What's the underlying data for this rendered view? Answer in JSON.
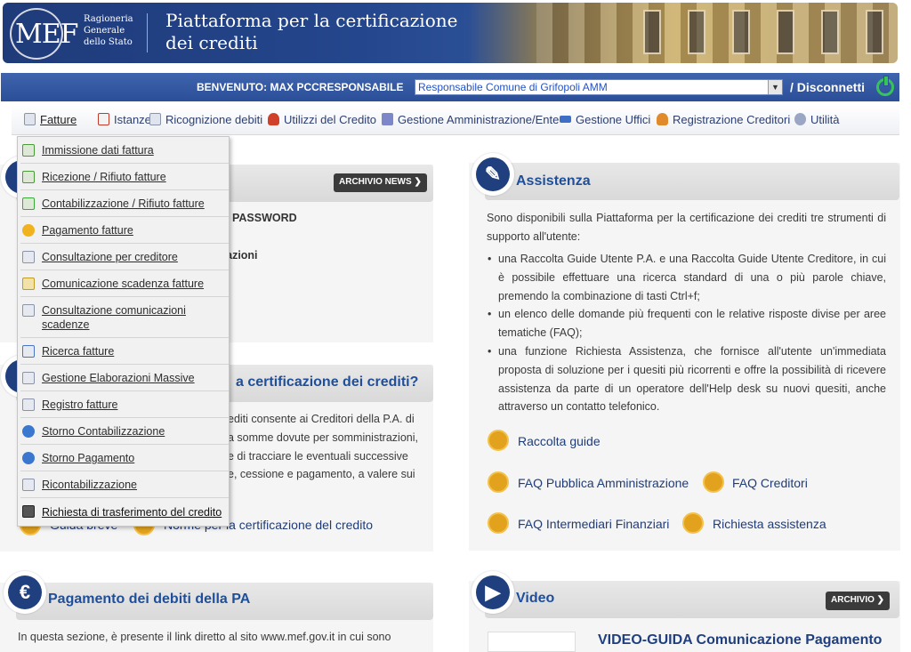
{
  "header": {
    "logo": "MEF",
    "org_lines": [
      "Ragioneria",
      "Generale",
      "dello Stato"
    ],
    "title_lines": [
      "Piattaforma per la certificazione",
      "dei crediti"
    ]
  },
  "userbar": {
    "welcome": "BENVENUTO: MAX PCCRESPONSABILE",
    "profile": "Responsabile Comune di Grifopoli AMM",
    "disconnect": "/ Disconnetti"
  },
  "menu": [
    {
      "label": "Fatture",
      "icon": "document-icon"
    },
    {
      "label": "Istanze",
      "icon": "pdf-document-icon"
    },
    {
      "label": "Ricognizione debiti",
      "icon": "document-icon"
    },
    {
      "label": "Utilizzi del Credito",
      "icon": "user-red-icon"
    },
    {
      "label": "Gestione Amministrazione/Ente",
      "icon": "book-icon"
    },
    {
      "label": "Gestione Uffici",
      "icon": "org-chart-icon"
    },
    {
      "label": "Registrazione Creditori",
      "icon": "user-orange-icon"
    },
    {
      "label": "Utilità",
      "icon": "gear-icon"
    }
  ],
  "dropdown": [
    "Immissione dati fattura",
    "Ricezione / Rifiuto fatture",
    "Contabilizzazione / Rifiuto fatture",
    "Pagamento fatture",
    "Consultazione per creditore",
    "Comunicazione scadenza fatture",
    "Consultazione comunicazioni scadenze",
    "Ricerca fatture",
    "Gestione Elaborazioni Massive",
    "Registro fatture",
    "Storno Contabilizzazione",
    "Storno Pagamento",
    "Ricontabilizzazione",
    "Richiesta di trasferimento del credito"
  ],
  "news": {
    "archive_button": "ARCHIVIO NEWS",
    "password_fragment": "PASSWORD",
    "info_fragment": "mazioni"
  },
  "certificazione": {
    "title_fragment": "a certificazione dei crediti?",
    "lines": [
      "editi consente ai Creditori della P.A. di",
      "a somme dovute per somministrazioni,",
      "e di tracciare le eventuali successive",
      "e, cessione e pagamento, a valere sui"
    ],
    "link1": "Guida breve",
    "link2": "Norme per la certificazione del credito"
  },
  "assistenza": {
    "title": "Assistenza",
    "intro": "Sono disponibili sulla Piattaforma per la certificazione dei crediti tre strumenti di supporto all'utente:",
    "bullets": [
      "una Raccolta Guide Utente P.A. e una Raccolta Guide Utente Creditore, in cui è possibile effettuare una ricerca standard di una o più parole chiave, premendo la combinazione di tasti Ctrl+f;",
      "un elenco delle domande più frequenti con le relative risposte divise per aree tematiche (FAQ);",
      "una funzione Richiesta Assistenza, che fornisce all'utente un'immediata proposta di soluzione per i quesiti più ricorrenti e offre la possibilità di ricevere assistenza da parte di un operatore dell'Help desk su nuovi quesiti, anche attraverso un contatto telefonico."
    ],
    "links": {
      "guide": "Raccolta guide",
      "faq_pa": "FAQ Pubblica Amministrazione",
      "faq_creditori": "FAQ Creditori",
      "faq_intermediari": "FAQ Intermediari Finanziari",
      "richiesta": "Richiesta assistenza"
    }
  },
  "pagamento": {
    "title": "Pagamento dei debiti della PA",
    "text": "In questa sezione, è presente il link diretto al sito www.mef.gov.it in cui sono"
  },
  "video": {
    "title": "Video",
    "archive_button": "ARCHIVIO",
    "item_title": "VIDEO-GUIDA Comunicazione Pagamento"
  },
  "colors": {
    "brand_blue": "#1f3f7e",
    "link_blue": "#1f4f9a",
    "accent_gold": "#e2a21d"
  }
}
